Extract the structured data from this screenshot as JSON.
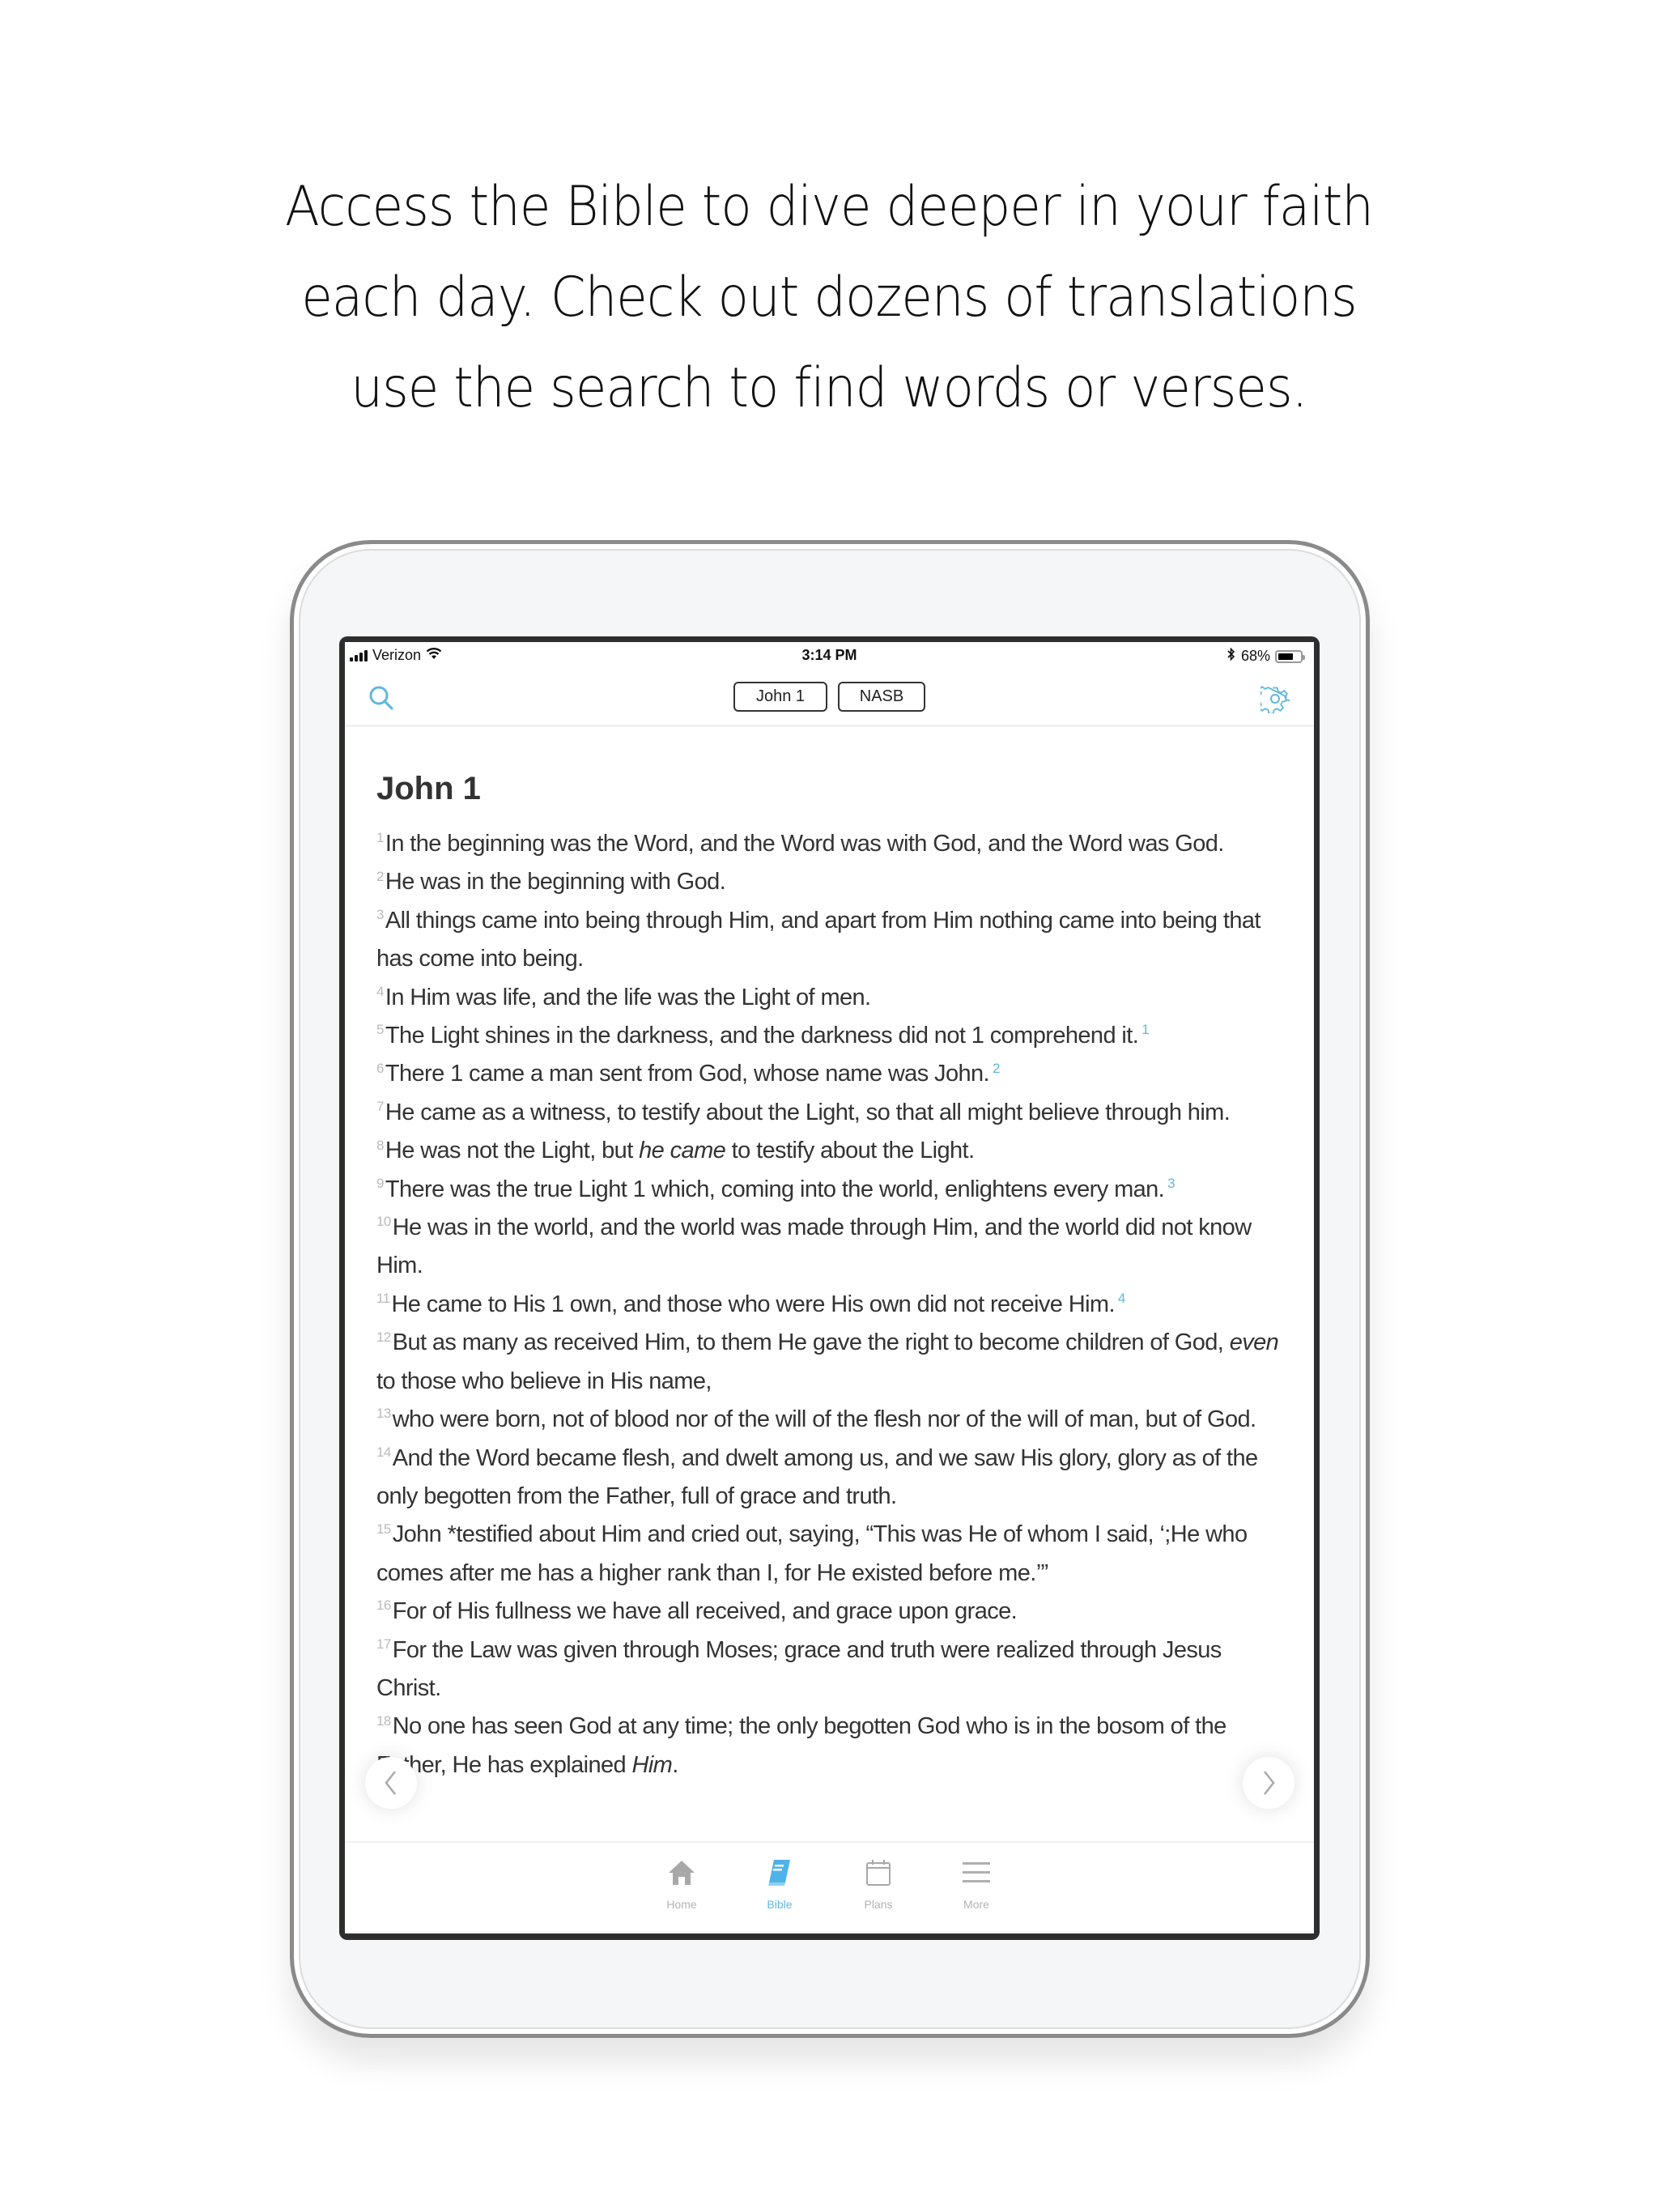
{
  "headline": {
    "lines": [
      "Access the Bible to dive deeper in your faith",
      "each day. Check out dozens of translations",
      "use the search to find words or verses."
    ]
  },
  "status_bar": {
    "carrier": "Verizon",
    "time": "3:14 PM",
    "battery": "68%",
    "battery_level": 0.68,
    "icons": [
      "signal-icon",
      "wifi-icon",
      "bluetooth-icon",
      "battery-icon"
    ]
  },
  "nav": {
    "search_icon": "search-icon",
    "settings_icon": "gear-icon",
    "reference_label": "John 1",
    "version_label": "NASB"
  },
  "colors": {
    "accent": "#5fb8dd",
    "text": "#333333",
    "verse_number": "#bbbbbb",
    "tab_inactive": "#b3b3b3"
  },
  "chapter": {
    "title": "John 1",
    "verses": [
      {
        "num": "1",
        "text": "In the beginning was the Word, and the Word was with God, and the Word was God.",
        "footnote": ""
      },
      {
        "num": "2",
        "text": "He was in the beginning with God.",
        "footnote": ""
      },
      {
        "num": "3",
        "text": "All things came into being through Him, and apart from Him nothing came into being that has come into being.",
        "footnote": ""
      },
      {
        "num": "4",
        "text": "In Him was life, and the life was the Light of men.",
        "footnote": ""
      },
      {
        "num": "5",
        "text": "The Light shines in the darkness, and the darkness did not 1 comprehend it.",
        "footnote": "1"
      },
      {
        "num": "6",
        "text": "There 1 came a man sent from God, whose name was John.",
        "footnote": "2"
      },
      {
        "num": "7",
        "text": "He came as a witness, to testify about the Light, so that all might believe through him.",
        "footnote": ""
      },
      {
        "num": "8",
        "text_before": "He was not the Light, but ",
        "italic": "he came",
        "text_after": " to testify about the Light.",
        "footnote": ""
      },
      {
        "num": "9",
        "text": "There was the true Light 1 which, coming into the world, enlightens every man.",
        "footnote": "3"
      },
      {
        "num": "10",
        "text": "He was in the world, and the world was made through Him, and the world did not know Him.",
        "footnote": ""
      },
      {
        "num": "11",
        "text": "He came to His 1 own, and those who were His own did not receive Him.",
        "footnote": "4"
      },
      {
        "num": "12",
        "text_before": "But as many as received Him, to them He gave the right to become children of God, ",
        "italic": "even",
        "text_after": " to those who believe in His name,",
        "footnote": ""
      },
      {
        "num": "13",
        "text": "who were born, not of blood nor of the will of the flesh nor of the will of man, but of God.",
        "footnote": ""
      },
      {
        "num": "14",
        "text": "And the Word became flesh, and dwelt among us, and we saw His glory, glory as of the only begotten from the Father, full of grace and truth.",
        "footnote": ""
      },
      {
        "num": "15",
        "text": "John *testified about Him and cried out, saying, “This was He of whom I said, ‘;He who comes after me has a higher rank than I, for He existed before me.’”",
        "footnote": ""
      },
      {
        "num": "16",
        "text": "For of His fullness we have all received, and grace upon grace.",
        "footnote": ""
      },
      {
        "num": "17",
        "text": "For the Law was given through Moses; grace and truth were realized through Jesus Christ.",
        "footnote": ""
      },
      {
        "num": "18",
        "text_before": "No one has seen God at any time; the only begotten God who is in the bosom of the Father, He has explained ",
        "italic": "Him",
        "text_after": ".",
        "footnote": ""
      }
    ]
  },
  "page_nav": {
    "prev_icon": "chevron-left-icon",
    "next_icon": "chevron-right-icon"
  },
  "tabs": [
    {
      "label": "Home",
      "icon": "home-icon",
      "active": false
    },
    {
      "label": "Bible",
      "icon": "book-icon",
      "active": true
    },
    {
      "label": "Plans",
      "icon": "calendar-icon",
      "active": false
    },
    {
      "label": "More",
      "icon": "menu-icon",
      "active": false
    }
  ]
}
